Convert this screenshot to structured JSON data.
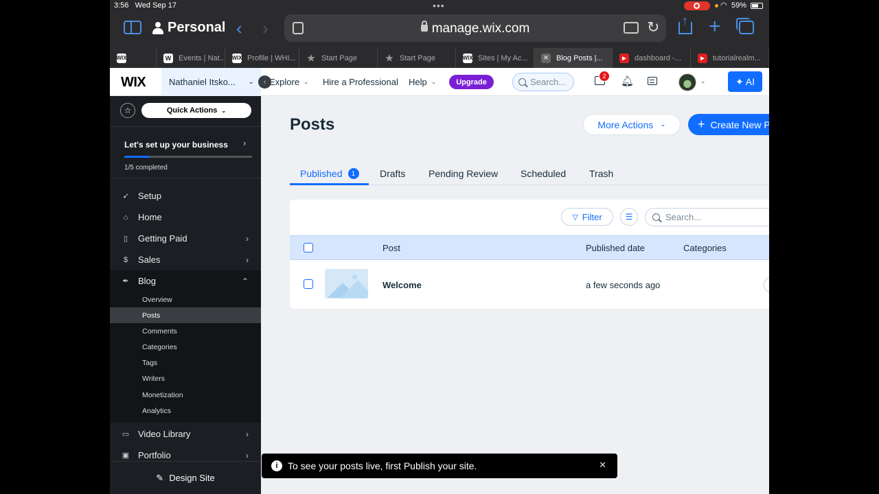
{
  "status_bar": {
    "time": "3:56",
    "date": "Wed Sep 17",
    "battery": "59%"
  },
  "browser": {
    "profile": "Personal",
    "url": "manage.wix.com",
    "tabs": [
      {
        "label": "",
        "favicon": "wix-favicon"
      },
      {
        "label": "Events | Nat...",
        "favicon": "w-favicon"
      },
      {
        "label": "Profile | WHI...",
        "favicon": "wix-favicon"
      },
      {
        "label": "Start Page",
        "favicon": "star-icon"
      },
      {
        "label": "Start Page",
        "favicon": "star-icon"
      },
      {
        "label": "Sites | My Ac...",
        "favicon": "wix-favicon"
      },
      {
        "label": "Blog Posts |...",
        "favicon": "close-icon",
        "active": true
      },
      {
        "label": "dashboard -...",
        "favicon": "youtube-favicon"
      },
      {
        "label": "tutorialrealm...",
        "favicon": "youtube-favicon"
      }
    ]
  },
  "wix_header": {
    "logo": "WIX",
    "site_name": "Nathaniel Itsko...",
    "nav": {
      "explore": "Explore",
      "hire": "Hire a Professional",
      "help": "Help"
    },
    "upgrade": "Upgrade",
    "search_placeholder": "Search...",
    "notifications_count": "2",
    "ai_label": "AI",
    "accent": "#116dff",
    "upgrade_color": "#7b1fd6"
  },
  "sidebar": {
    "quick_actions": "Quick Actions",
    "setup_title": "Let's set up your business",
    "setup_progress": 0.2,
    "setup_count": "1/5 completed",
    "items": [
      {
        "label": "Setup",
        "icon": "rocket-icon"
      },
      {
        "label": "Home",
        "icon": "home-icon"
      },
      {
        "label": "Getting Paid",
        "icon": "payment-icon"
      },
      {
        "label": "Sales",
        "icon": "dollar-icon"
      },
      {
        "label": "Blog",
        "icon": "pen-icon"
      }
    ],
    "blog_sub": [
      "Overview",
      "Posts",
      "Comments",
      "Categories",
      "Tags",
      "Writers",
      "Monetization",
      "Analytics"
    ],
    "bottom_items": [
      {
        "label": "Video Library",
        "icon": "video-icon"
      },
      {
        "label": "Portfolio",
        "icon": "portfolio-icon"
      }
    ],
    "design_site": "Design Site"
  },
  "main": {
    "title": "Posts",
    "more_actions": "More Actions",
    "create_new": "Create New Post",
    "tabs": [
      {
        "label": "Published",
        "count": "1"
      },
      {
        "label": "Drafts"
      },
      {
        "label": "Pending Review"
      },
      {
        "label": "Scheduled"
      },
      {
        "label": "Trash"
      }
    ],
    "filter": "Filter",
    "search_placeholder": "Search...",
    "columns": {
      "post": "Post",
      "published_date": "Published date",
      "categories": "Categories"
    },
    "rows": [
      {
        "title": "Welcome",
        "published": "a few seconds ago",
        "categories": ""
      }
    ]
  },
  "toast": {
    "message": "To see your posts live, first Publish your site."
  }
}
